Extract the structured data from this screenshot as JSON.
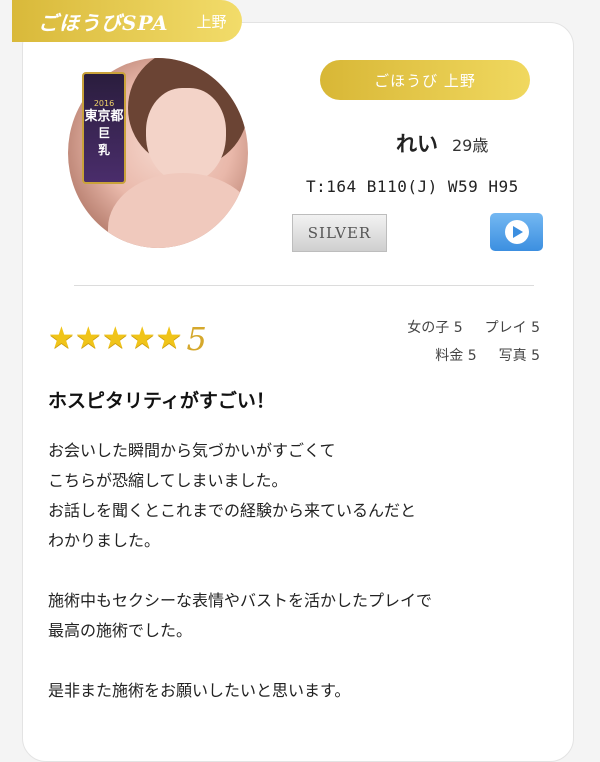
{
  "header": {
    "brand_logo": "ごほうびSPA",
    "area": "上野"
  },
  "profile": {
    "shop": "ごほうび 上野",
    "name": "れい",
    "age": "29歳",
    "stats": "T:164 B110(J) W59 H95",
    "rank": "SILVER",
    "badge": {
      "top": "2016",
      "region": "東京都",
      "line1": "巨",
      "line2": "乳"
    }
  },
  "review": {
    "rating": 5,
    "score_label": "5",
    "scores": [
      {
        "label": "女の子",
        "value": "5"
      },
      {
        "label": "プレイ",
        "value": "5"
      },
      {
        "label": "料金",
        "value": "5"
      },
      {
        "label": "写真",
        "value": "5"
      }
    ],
    "title": "ホスピタリティがすごい！",
    "paragraphs": [
      "お会いした瞬間から気づかいがすごくて",
      "こちらが恐縮してしまいました。",
      "お話しを聞くとこれまでの経験から来ているんだと",
      "わかりました。",
      "",
      "施術中もセクシーな表情やバストを活かしたプレイで",
      "最高の施術でした。",
      "",
      "是非また施術をお願いしたいと思います。"
    ]
  },
  "colors": {
    "gold": "#d9b93a",
    "star": "#f0c419",
    "video_blue": "#3c8fe0"
  }
}
